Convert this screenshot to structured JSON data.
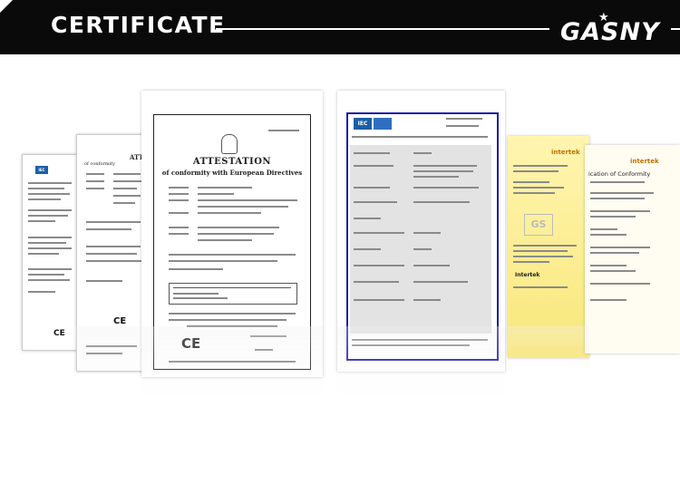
{
  "header": {
    "title": "CERTIFICATE",
    "brand": "GASNY"
  },
  "attestation": {
    "title": "ATTESTATION",
    "subtitle": "of conformity with European Directives",
    "mark": "CE"
  },
  "second_doc": {
    "title": "ATTE",
    "subtitle": "of conformity",
    "mark": "CE"
  },
  "iec_doc": {
    "logo": "IEC"
  },
  "far_left_doc": {
    "logo": "IEC",
    "mark": "CE"
  },
  "intertek_doc": {
    "brand": "intertek",
    "watermark": "GS",
    "footer_brand": "Intertek"
  },
  "right_doc": {
    "brand": "intertek",
    "title": "ication of Conformity"
  },
  "colors": {
    "header_bg": "#0a0a0a",
    "iec_blue": "#1a1aa8",
    "intertek_yellow": "#f9e77a"
  }
}
